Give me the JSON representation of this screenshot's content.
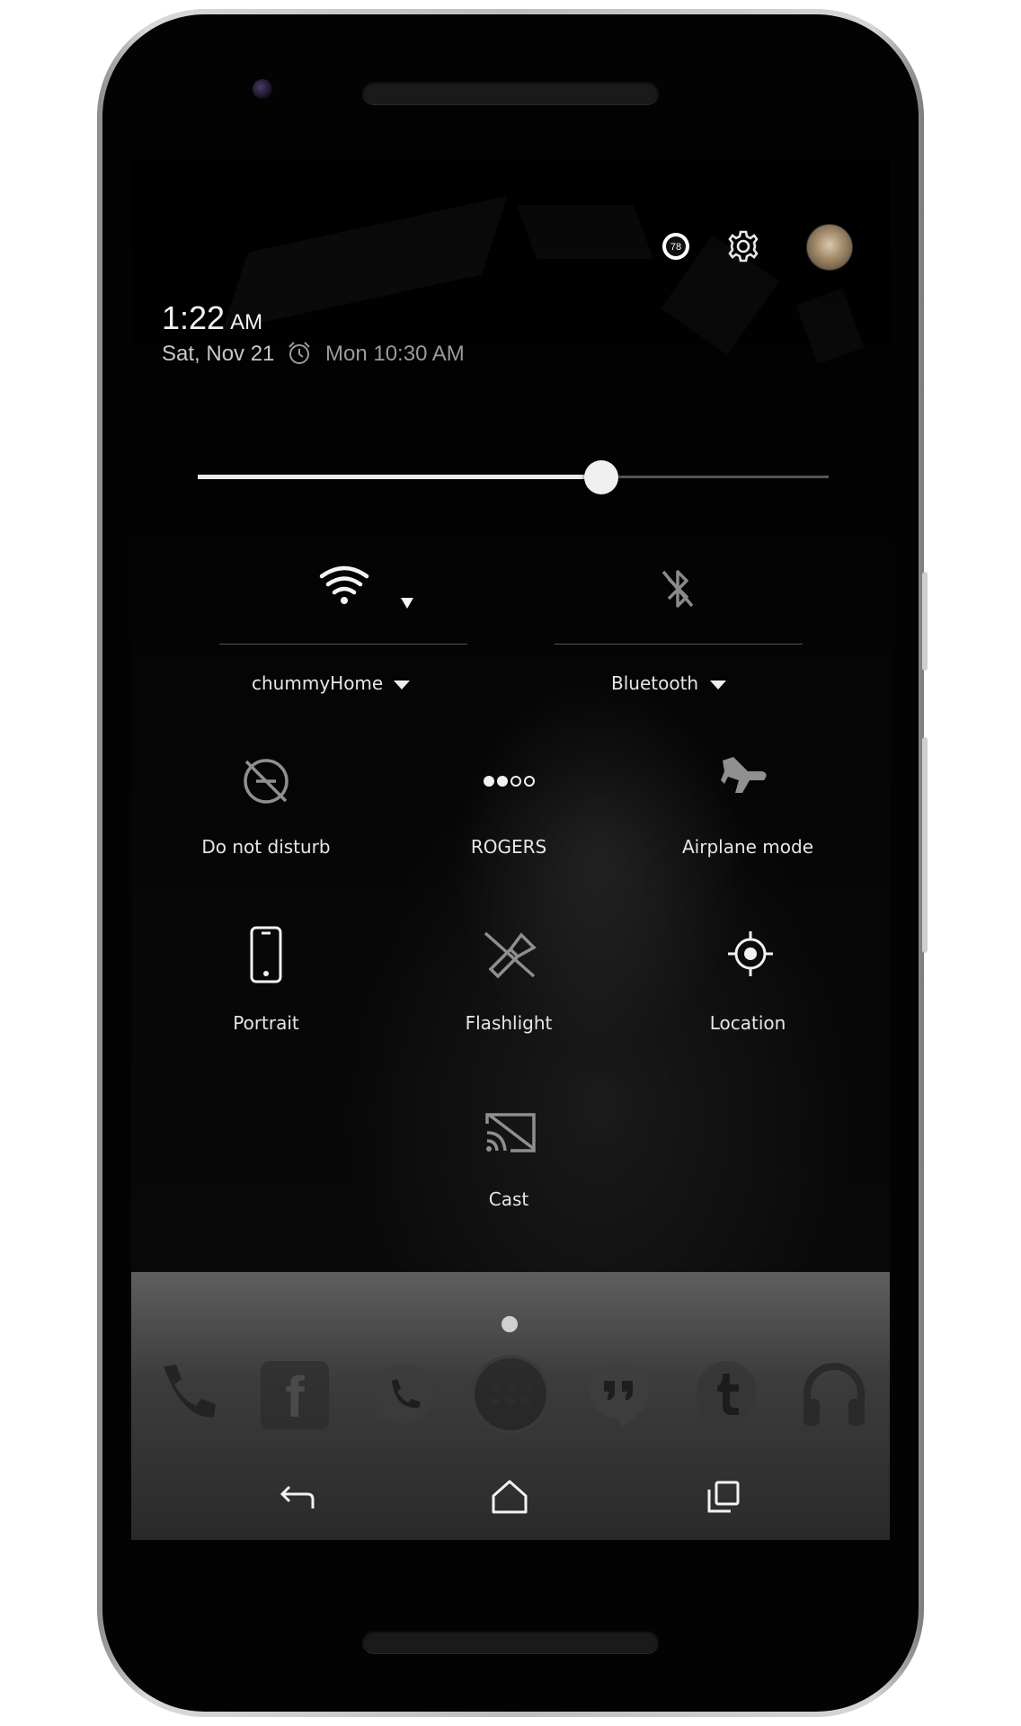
{
  "status": {
    "time": "1:22",
    "ampm": "AM",
    "date": "Sat, Nov 21",
    "alarm": "Mon 10:30 AM",
    "badge_count": "78"
  },
  "brightness": {
    "level_percent": 64
  },
  "quick_settings": {
    "wifi": {
      "label": "chummyHome"
    },
    "bluetooth": {
      "label": "Bluetooth"
    },
    "tiles": [
      {
        "label": "Do not disturb",
        "icon": "do-not-disturb-icon"
      },
      {
        "label": "ROGERS",
        "icon": "cellular-signal-icon"
      },
      {
        "label": "Airplane mode",
        "icon": "airplane-icon"
      },
      {
        "label": "Portrait",
        "icon": "portrait-phone-icon"
      },
      {
        "label": "Flashlight",
        "icon": "flashlight-off-icon"
      },
      {
        "label": "Location",
        "icon": "location-crosshair-icon"
      },
      {
        "label": "Cast",
        "icon": "cast-icon"
      }
    ]
  },
  "dock": {
    "apps": [
      "phone-icon",
      "facebook-icon",
      "whatsapp-icon",
      "app-drawer-icon",
      "hangouts-icon",
      "tumblr-icon",
      "headphones-icon"
    ]
  },
  "navigation": [
    "back-icon",
    "home-icon",
    "recents-icon"
  ],
  "colors": {
    "accent": "#f0f0f0",
    "background": "#000000",
    "frame": "#bdbdbd"
  }
}
